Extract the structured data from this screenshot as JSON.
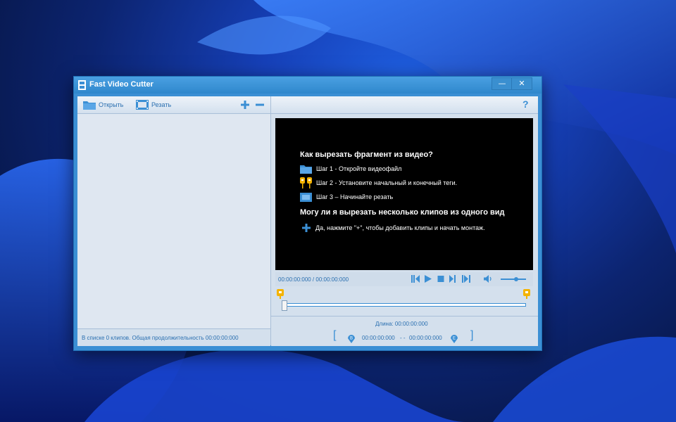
{
  "window": {
    "title": "Fast Video Cutter",
    "minimize_label": "—",
    "close_label": "✕"
  },
  "toolbar": {
    "open_label": "Открыть",
    "cut_label": "Резать",
    "add_icon": "plus-icon",
    "remove_icon": "minus-icon",
    "help_label": "?"
  },
  "status": {
    "list_text": "В списке 0 клипов. Общая продолжительность 00:00:00:000"
  },
  "help": {
    "heading1": "Как вырезать фрагмент из видео?",
    "step1": "Шаг 1 - Откройте видеофайл",
    "step2": "Шаг 2 - Установите начальный и конечный теги.",
    "step3": "Шаг 3 – Начинайте резать",
    "heading2": "Могу ли я вырезать несколько клипов из одного вид",
    "tip": "Да, нажмите \"+\", чтобы добавить клипы и начать монтаж."
  },
  "player": {
    "time": "00:00:00:000 / 00:00:00:000",
    "volume_level": 0.6
  },
  "clip": {
    "length": "Длина: 00:00:00:000",
    "start": "00:00:00:000",
    "separator": "- -",
    "end": "00:00:00:000",
    "open_bracket": "[",
    "close_bracket": "]"
  },
  "colors": {
    "accent": "#3b8fd4",
    "text_blue": "#2a6fb0"
  }
}
